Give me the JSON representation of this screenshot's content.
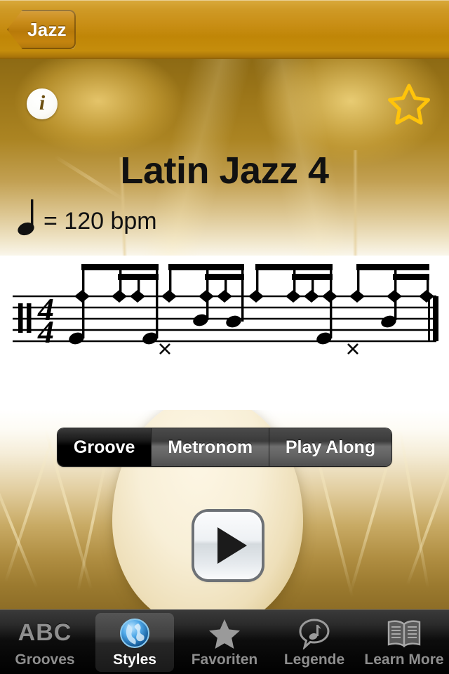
{
  "navbar": {
    "back_label": "Jazz",
    "back_icon": "chevron-left-icon",
    "accent_color": "#c08607"
  },
  "header": {
    "info_icon": "info-icon",
    "info_glyph": "i",
    "favorite_icon": "star-outline-icon",
    "favorite_color": "#ffc40a",
    "favorite_active": "false"
  },
  "content": {
    "title": "Latin Jazz 4",
    "tempo": {
      "note_icon": "quarter-note-icon",
      "text": "= 120 bpm",
      "value": 120,
      "unit": "bpm"
    },
    "notation": {
      "clef": "percussion-clef",
      "time_signature_numerator": "4",
      "time_signature_denominator": "4",
      "end_barline": "final-double-barline"
    }
  },
  "segmented_control": {
    "selected_index": 0,
    "segments": [
      {
        "label": "Groove",
        "selected": true
      },
      {
        "label": "Metronom",
        "selected": false
      },
      {
        "label": "Play Along",
        "selected": false
      }
    ]
  },
  "transport": {
    "play_icon": "play-icon",
    "state": "stopped"
  },
  "tabbar": {
    "selected_index": 1,
    "tabs": [
      {
        "label": "Grooves",
        "icon": "abc-icon",
        "selected": false
      },
      {
        "label": "Styles",
        "icon": "globe-icon",
        "selected": true
      },
      {
        "label": "Favoriten",
        "icon": "star-icon",
        "selected": false
      },
      {
        "label": "Legende",
        "icon": "speech-bubble-note-icon",
        "selected": false
      },
      {
        "label": "Learn More",
        "icon": "open-book-icon",
        "selected": false
      }
    ]
  }
}
